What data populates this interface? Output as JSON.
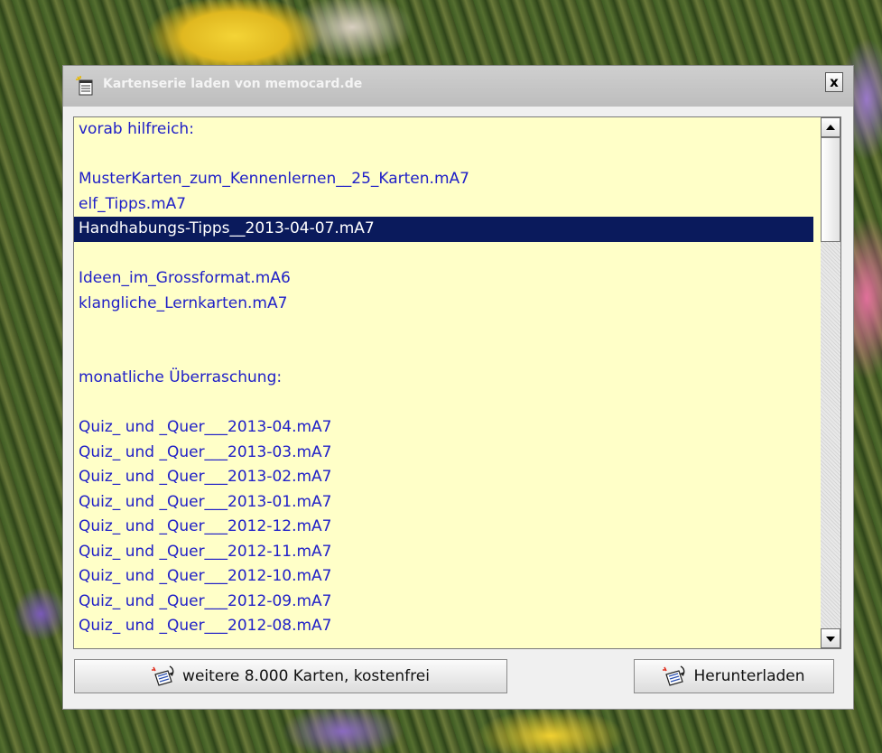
{
  "window": {
    "title": "Kartenserie laden von memocard.de",
    "close_label": "x"
  },
  "list": {
    "items": [
      {
        "text": "vorab hilfreich:",
        "selected": false
      },
      {
        "text": "",
        "selected": false
      },
      {
        "text": "MusterKarten_zum_Kennenlernen__25_Karten.mA7",
        "selected": false
      },
      {
        "text": "elf_Tipps.mA7",
        "selected": false
      },
      {
        "text": "Handhabungs-Tipps__2013-04-07.mA7",
        "selected": true
      },
      {
        "text": "",
        "selected": false
      },
      {
        "text": "Ideen_im_Grossformat.mA6",
        "selected": false
      },
      {
        "text": "klangliche_Lernkarten.mA7",
        "selected": false
      },
      {
        "text": "",
        "selected": false
      },
      {
        "text": "",
        "selected": false
      },
      {
        "text": "monatliche Überraschung:",
        "selected": false
      },
      {
        "text": "",
        "selected": false
      },
      {
        "text": "Quiz_ und _Quer___2013-04.mA7",
        "selected": false
      },
      {
        "text": "Quiz_ und _Quer___2013-03.mA7",
        "selected": false
      },
      {
        "text": "Quiz_ und _Quer___2013-02.mA7",
        "selected": false
      },
      {
        "text": "Quiz_ und _Quer___2013-01.mA7",
        "selected": false
      },
      {
        "text": "Quiz_ und _Quer___2012-12.mA7",
        "selected": false
      },
      {
        "text": "Quiz_ und _Quer___2012-11.mA7",
        "selected": false
      },
      {
        "text": "Quiz_ und _Quer___2012-10.mA7",
        "selected": false
      },
      {
        "text": "Quiz_ und _Quer___2012-09.mA7",
        "selected": false
      },
      {
        "text": "Quiz_ und _Quer___2012-08.mA7",
        "selected": false
      }
    ]
  },
  "buttons": {
    "more_cards_label": "weitere 8.000 Karten, kostenfrei",
    "download_label": "Herunterladen"
  },
  "colors": {
    "list_background": "#ffffc8",
    "list_text": "#2020c8",
    "selection_background": "#0a1a5c",
    "selection_text": "#ffffff"
  },
  "icons": {
    "title": "notepad-sparkle-icon",
    "buttons": "card-download-icon"
  }
}
